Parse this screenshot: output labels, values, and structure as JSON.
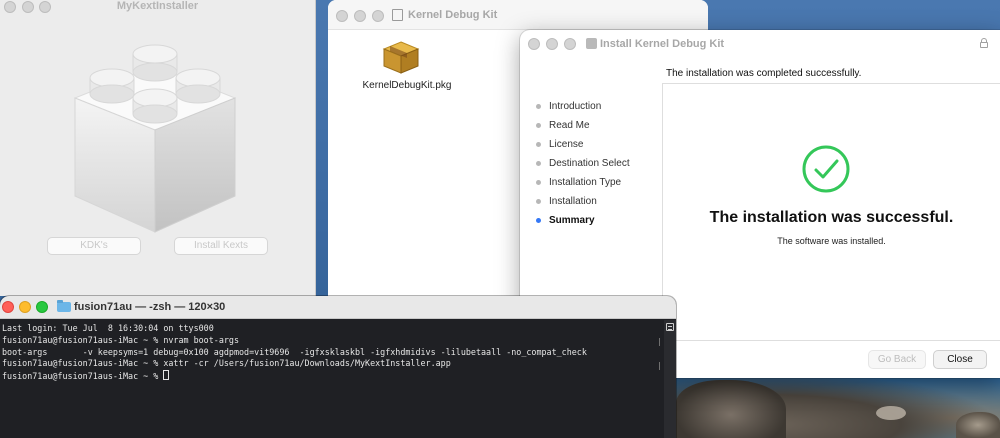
{
  "kext_window": {
    "title": "MyKextInstaller",
    "buttons": [
      "KDK's",
      "Install Kexts"
    ]
  },
  "finder_window": {
    "title": "Kernel Debug Kit",
    "file": {
      "name": "KernelDebugKit.pkg",
      "icon": "package-icon"
    }
  },
  "installer": {
    "title": "Install Kernel Debug Kit",
    "header": "The installation was completed successfully.",
    "steps": [
      {
        "label": "Introduction"
      },
      {
        "label": "Read Me"
      },
      {
        "label": "License"
      },
      {
        "label": "Destination Select"
      },
      {
        "label": "Installation Type"
      },
      {
        "label": "Installation"
      },
      {
        "label": "Summary",
        "active": true
      }
    ],
    "success_title": "The installation was successful.",
    "success_subtitle": "The software was installed.",
    "buttons": {
      "back": "Go Back",
      "close": "Close"
    },
    "accent_color": "#3478f6",
    "success_color": "#34c759"
  },
  "terminal": {
    "title": "fusion71au — -zsh — 120×30",
    "lines": [
      "Last login: Tue Jul  8 16:30:04 on ttys000",
      "fusion71au@fusion71aus-iMac ~ % nvram boot-args",
      "boot-args       -v keepsyms=1 debug=0x100 agdpmod=vit9696  -igfxsklaskbl -igfxhdmidivs -lilubetaall -no_compat_check",
      "fusion71au@fusion71aus-iMac ~ % xattr -cr /Users/fusion71au/Downloads/MyKextInstaller.app",
      "fusion71au@fusion71aus-iMac ~ % "
    ]
  }
}
